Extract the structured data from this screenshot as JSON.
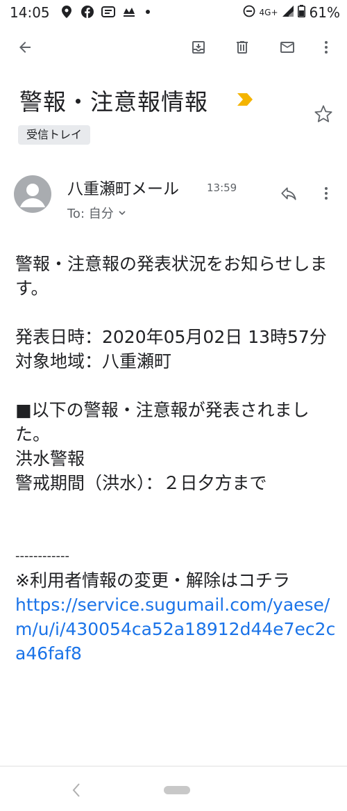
{
  "status_bar": {
    "time": "14:05",
    "network": "4G+",
    "battery": "61%"
  },
  "toolbar": {
    "back_icon": "arrow-left-icon",
    "archive_icon": "archive-icon",
    "delete_icon": "trash-icon",
    "mail_icon": "mail-icon",
    "more_icon": "more-vert-icon"
  },
  "email": {
    "subject": "警報・注意報情報",
    "label": "受信トレイ",
    "importance_color": "#f4b400",
    "sender_name": "八重瀬町メール",
    "sent_time": "13:59",
    "to_line": "To: 自分",
    "body": {
      "intro": "警報・注意報の発表状況をお知らせします。",
      "date_line": "発表日時：2020年05月02日 13時57分",
      "area_line": "対象地域：八重瀬町",
      "issued_line": "■以下の警報・注意報が発表されました。",
      "warning_name": "洪水警報",
      "period_line": "警戒期間（洪水）：２日夕方まで",
      "separator": "------------",
      "footer_note": "※利用者情報の変更・解除はコチラ",
      "link": "https://service.sugumail.com/yaese/m/u/i/430054ca52a18912d44e7ec2ca46faf8"
    }
  },
  "colors": {
    "link": "#1a73e8",
    "chip_bg": "#e8eaed",
    "avatar_bg": "#a9acb0"
  }
}
